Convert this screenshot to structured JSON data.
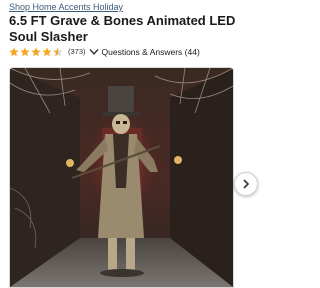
{
  "breadcrumb": {
    "label": "Shop Home Accents Holiday"
  },
  "product": {
    "title": "6.5 FT Grave & Bones Animated LED Soul Slasher",
    "rating": 4.5,
    "rating_max": 5,
    "review_count": "(373)",
    "qa_label": "Questions & Answers (44)"
  },
  "gallery": {
    "image_alt": "Animated skeleton figure in tattered coat and top hat in a haunted hallway",
    "next_icon": "chevron-right-icon"
  },
  "colors": {
    "star": "#f5a623",
    "link": "#3b5b7a",
    "title": "#1a1a1a"
  }
}
